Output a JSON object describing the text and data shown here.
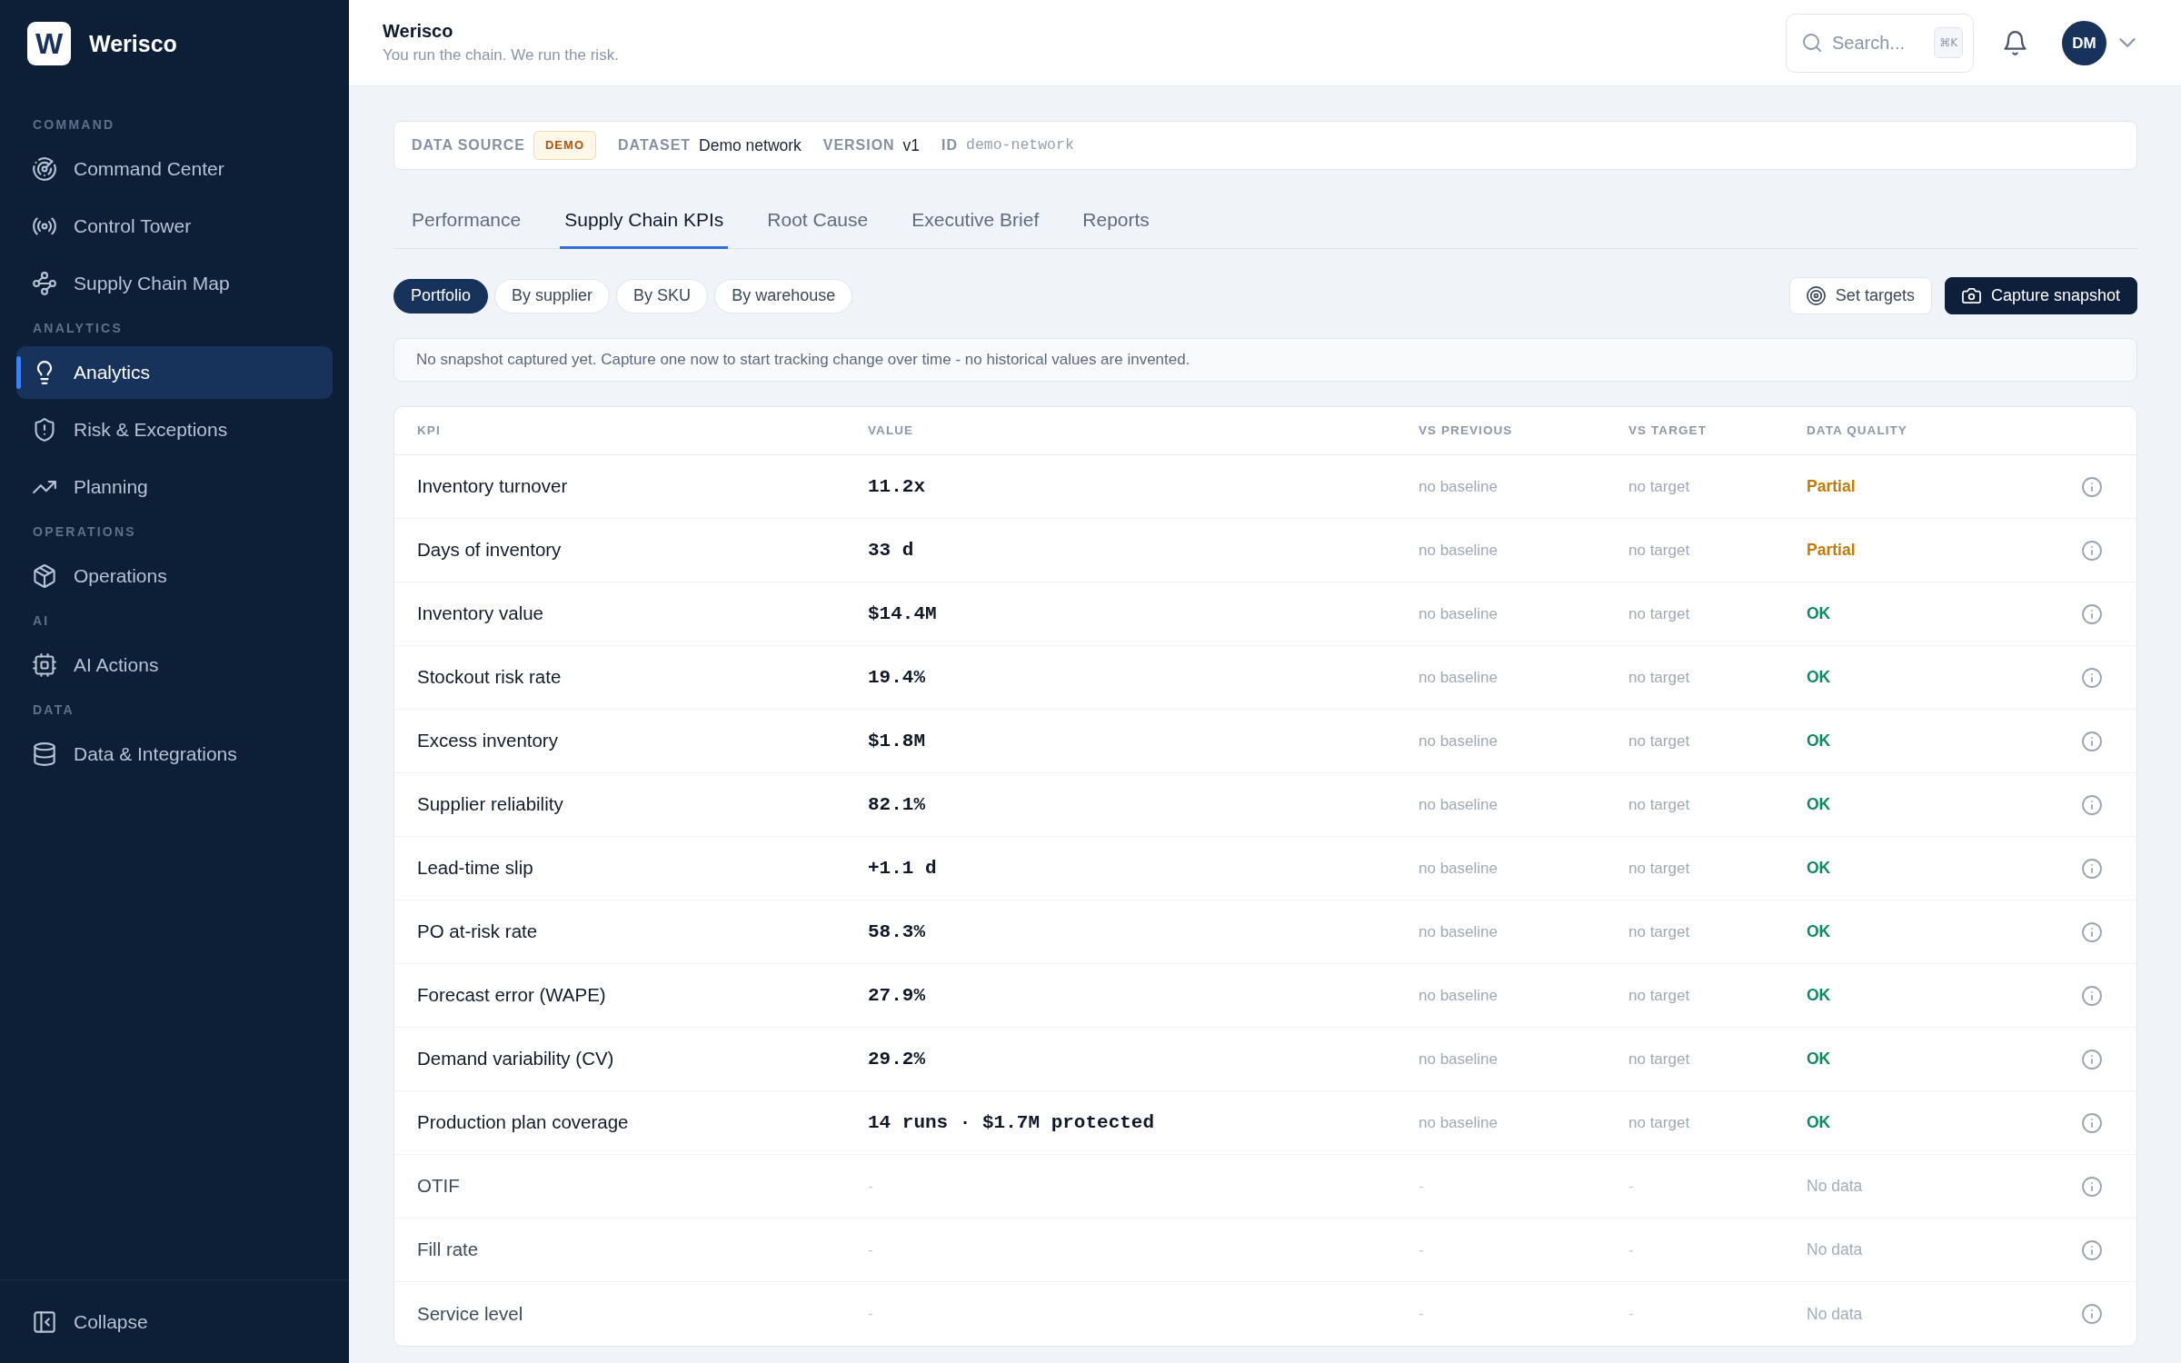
{
  "sidebar": {
    "brand": {
      "mark": "W",
      "name": "Werisco"
    },
    "sections": [
      {
        "label": "COMMAND",
        "items": [
          {
            "label": "Command Center",
            "selected": false
          },
          {
            "label": "Control Tower",
            "selected": false
          },
          {
            "label": "Supply Chain Map",
            "selected": false
          }
        ]
      },
      {
        "label": "ANALYTICS",
        "items": [
          {
            "label": "Analytics",
            "selected": true
          },
          {
            "label": "Risk & Exceptions",
            "selected": false
          },
          {
            "label": "Planning",
            "selected": false
          }
        ]
      },
      {
        "label": "OPERATIONS",
        "items": [
          {
            "label": "Operations",
            "selected": false
          }
        ]
      },
      {
        "label": "AI",
        "items": [
          {
            "label": "AI Actions",
            "selected": false
          }
        ]
      },
      {
        "label": "DATA",
        "items": [
          {
            "label": "Data & Integrations",
            "selected": false
          }
        ]
      }
    ],
    "collapse": "Collapse"
  },
  "header": {
    "title": "Werisco",
    "subtitle": "You run the chain. We run the risk.",
    "search": {
      "placeholder": "Search...",
      "shortcut": "⌘K"
    },
    "avatar": "DM"
  },
  "data_source": {
    "label": "DATA SOURCE",
    "badge": "DEMO",
    "fields": [
      {
        "label": "DATASET",
        "value": "Demo network",
        "kind": "text"
      },
      {
        "label": "VERSION",
        "value": "v1",
        "kind": "text"
      },
      {
        "label": "ID",
        "value": "demo-network",
        "kind": "code"
      }
    ]
  },
  "tabs": [
    {
      "label": "Performance",
      "selected": false
    },
    {
      "label": "Supply Chain KPIs",
      "selected": true
    },
    {
      "label": "Root Cause",
      "selected": false
    },
    {
      "label": "Executive Brief",
      "selected": false
    },
    {
      "label": "Reports",
      "selected": false
    }
  ],
  "scopes": [
    {
      "label": "Portfolio",
      "selected": true
    },
    {
      "label": "By supplier",
      "selected": false
    },
    {
      "label": "By SKU",
      "selected": false
    },
    {
      "label": "By warehouse",
      "selected": false
    }
  ],
  "actions": [
    {
      "label": "Set targets",
      "kind": "secondary"
    },
    {
      "label": "Capture snapshot",
      "kind": "primary"
    }
  ],
  "notice": "No snapshot captured yet. Capture one now to start tracking change over time - no historical values are invented.",
  "table": {
    "columns": [
      "KPI",
      "VALUE",
      "VS PREVIOUS",
      "VS TARGET",
      "DATA QUALITY"
    ],
    "rows": [
      {
        "kpi": "Inventory turnover",
        "value": "11.2x",
        "vs_previous": "no baseline",
        "vs_target": "no target",
        "quality": "Partial",
        "kind": "partial"
      },
      {
        "kpi": "Days of inventory",
        "value": "33 d",
        "vs_previous": "no baseline",
        "vs_target": "no target",
        "quality": "Partial",
        "kind": "partial"
      },
      {
        "kpi": "Inventory value",
        "value": "$14.4M",
        "vs_previous": "no baseline",
        "vs_target": "no target",
        "quality": "OK",
        "kind": "ok"
      },
      {
        "kpi": "Stockout risk rate",
        "value": "19.4%",
        "vs_previous": "no baseline",
        "vs_target": "no target",
        "quality": "OK",
        "kind": "ok"
      },
      {
        "kpi": "Excess inventory",
        "value": "$1.8M",
        "vs_previous": "no baseline",
        "vs_target": "no target",
        "quality": "OK",
        "kind": "ok"
      },
      {
        "kpi": "Supplier reliability",
        "value": "82.1%",
        "vs_previous": "no baseline",
        "vs_target": "no target",
        "quality": "OK",
        "kind": "ok"
      },
      {
        "kpi": "Lead-time slip",
        "value": "+1.1 d",
        "vs_previous": "no baseline",
        "vs_target": "no target",
        "quality": "OK",
        "kind": "ok"
      },
      {
        "kpi": "PO at-risk rate",
        "value": "58.3%",
        "vs_previous": "no baseline",
        "vs_target": "no target",
        "quality": "OK",
        "kind": "ok"
      },
      {
        "kpi": "Forecast error (WAPE)",
        "value": "27.9%",
        "vs_previous": "no baseline",
        "vs_target": "no target",
        "quality": "OK",
        "kind": "ok"
      },
      {
        "kpi": "Demand variability (CV)",
        "value": "29.2%",
        "vs_previous": "no baseline",
        "vs_target": "no target",
        "quality": "OK",
        "kind": "ok"
      },
      {
        "kpi": "Production plan coverage",
        "value": "14 runs · $1.7M protected",
        "vs_previous": "no baseline",
        "vs_target": "no target",
        "quality": "OK",
        "kind": "ok"
      },
      {
        "kpi": "OTIF",
        "value": "-",
        "vs_previous": "-",
        "vs_target": "-",
        "quality": "No data",
        "kind": "missing"
      },
      {
        "kpi": "Fill rate",
        "value": "-",
        "vs_previous": "-",
        "vs_target": "-",
        "quality": "No data",
        "kind": "missing"
      },
      {
        "kpi": "Service level",
        "value": "-",
        "vs_previous": "-",
        "vs_target": "-",
        "quality": "No data",
        "kind": "missing"
      }
    ]
  }
}
